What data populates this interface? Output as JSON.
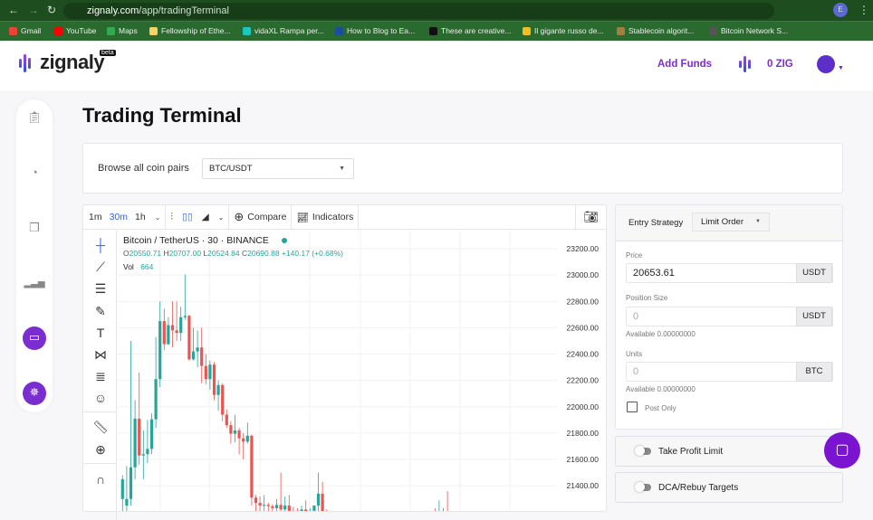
{
  "browser": {
    "url_domain": "zignaly.com",
    "url_path": "/app/tradingTerminal",
    "bookmarks": [
      {
        "label": "Gmail",
        "color": "#ea4335"
      },
      {
        "label": "YouTube",
        "color": "#ff0000"
      },
      {
        "label": "Maps",
        "color": "#34a853"
      },
      {
        "label": "Fellowship of Ethe...",
        "color": "#f6d365"
      },
      {
        "label": "vidaXL Rampa per...",
        "color": "#1cc7c1"
      },
      {
        "label": "How to Blog to Ea...",
        "color": "#1a4fa0"
      },
      {
        "label": "These are creative...",
        "color": "#111111"
      },
      {
        "label": "Il gigante russo de...",
        "color": "#f0c020"
      },
      {
        "label": "Stablecoin algorit...",
        "color": "#a08040"
      },
      {
        "label": "Bitcoin Network S...",
        "color": "#555555"
      }
    ],
    "profile_initial": "E"
  },
  "header": {
    "logo": "zignaly",
    "logo_badge": "beta",
    "add_funds": "Add Funds",
    "balance": "0 ZIG",
    "accent": "#7a2ed0"
  },
  "sidebar": {
    "items": [
      {
        "icon": "clipboard-icon"
      },
      {
        "icon": "pie-chart-icon"
      },
      {
        "icon": "copy-icon"
      },
      {
        "icon": "signal-icon"
      },
      {
        "icon": "monitor-icon",
        "active": true
      },
      {
        "icon": "settings-icon",
        "active": true
      }
    ]
  },
  "page": {
    "title": "Trading Terminal"
  },
  "pair": {
    "label": "Browse all coin pairs",
    "selected": "BTC/USDT"
  },
  "toolbar": {
    "intervals": [
      "1m",
      "30m",
      "1h"
    ],
    "active_interval": "30m",
    "compare": "Compare",
    "indicators": "Indicators"
  },
  "legend": {
    "symbol": "Bitcoin / TetherUS · 30 · BINANCE",
    "o_label": "O",
    "o": "20550.71",
    "h_label": "H",
    "h": "20707.00",
    "l_label": "L",
    "l": "20524.84",
    "c_label": "C",
    "c": "20690.88",
    "change": "+140.17 (+0.68%)",
    "vol_label": "Vol",
    "vol": "664"
  },
  "chart_data": {
    "type": "candlestick",
    "y_ticks": [
      23200,
      23000,
      22800,
      22600,
      22400,
      22200,
      22000,
      21800,
      21600,
      21400
    ],
    "y_tick_labels": [
      "23200.00",
      "23000.00",
      "22800.00",
      "22600.00",
      "22400.00",
      "22200.00",
      "22000.00",
      "21800.00",
      "21600.00",
      "21400.00"
    ],
    "ylim": [
      21237,
      23330
    ],
    "grid": true,
    "up_color": "#26a69a",
    "down_color": "#ef5350",
    "candles_ohlc": [
      [
        21300,
        21480,
        21200,
        21450
      ],
      [
        21250,
        21550,
        21150,
        21300
      ],
      [
        21300,
        22500,
        21250,
        21540
      ],
      [
        21540,
        22050,
        21450,
        21910
      ],
      [
        21910,
        22260,
        21560,
        21630
      ],
      [
        21630,
        21820,
        21450,
        21640
      ],
      [
        21640,
        21900,
        21570,
        21680
      ],
      [
        21680,
        21950,
        21640,
        21905
      ],
      [
        21905,
        22530,
        21840,
        22210
      ],
      [
        22210,
        22800,
        22150,
        22650
      ],
      [
        22650,
        22745,
        22430,
        22475
      ],
      [
        22475,
        22680,
        22470,
        22620
      ],
      [
        22620,
        22800,
        22450,
        22580
      ],
      [
        22580,
        22800,
        22500,
        22560
      ],
      [
        22560,
        22760,
        22500,
        22680
      ],
      [
        22680,
        23005,
        22660,
        22690
      ],
      [
        22690,
        22700,
        22350,
        22360
      ],
      [
        22360,
        22600,
        22350,
        22420
      ],
      [
        22420,
        22580,
        22300,
        22450
      ],
      [
        22450,
        22600,
        22180,
        22310
      ],
      [
        22310,
        22400,
        22170,
        22210
      ],
      [
        22210,
        22350,
        22130,
        22320
      ],
      [
        22320,
        22340,
        22050,
        22090
      ],
      [
        22090,
        22200,
        21970,
        22165
      ],
      [
        22165,
        22180,
        21890,
        21940
      ],
      [
        21940,
        21980,
        21840,
        21860
      ],
      [
        21860,
        21890,
        21720,
        21795
      ],
      [
        21795,
        21940,
        21730,
        21820
      ],
      [
        21820,
        21840,
        21640,
        21760
      ],
      [
        21760,
        21800,
        21600,
        21735
      ],
      [
        21735,
        21880,
        21720,
        21780
      ],
      [
        21780,
        21790,
        21250,
        21310
      ],
      [
        21310,
        21330,
        21200,
        21270
      ],
      [
        21270,
        21320,
        21200,
        21250
      ],
      [
        21250,
        21330,
        21200,
        21255
      ],
      [
        21255,
        21270,
        21200,
        21245
      ],
      [
        21245,
        21260,
        21180,
        21230
      ],
      [
        21230,
        21300,
        21180,
        21255
      ],
      [
        21255,
        21500,
        21180,
        21220
      ],
      [
        21220,
        21320,
        21180,
        21250
      ],
      [
        21250,
        21330,
        21150,
        21210
      ],
      [
        21210,
        21240,
        21150,
        21200
      ],
      [
        21200,
        21230,
        21150,
        21190
      ],
      [
        21190,
        21250,
        21150,
        21220
      ],
      [
        21220,
        21290,
        21150,
        21200
      ],
      [
        21200,
        21230,
        21150,
        21210
      ],
      [
        21210,
        21250,
        21150,
        21250
      ],
      [
        21250,
        21500,
        21200,
        21340
      ],
      [
        21340,
        21430,
        21150,
        21200
      ],
      [
        21200,
        21220,
        21120,
        21180
      ],
      [
        21180,
        21210,
        21120,
        21190
      ],
      [
        21190,
        21200,
        21110,
        21150
      ],
      [
        21150,
        21190,
        21100,
        21170
      ],
      [
        21170,
        21200,
        21120,
        21140
      ],
      [
        21140,
        21180,
        21100,
        21160
      ],
      [
        21160,
        21200,
        21120,
        21130
      ],
      [
        21130,
        21170,
        21090,
        21150
      ],
      [
        21150,
        21190,
        21100,
        21120
      ],
      [
        21120,
        21160,
        21080,
        21140
      ],
      [
        21140,
        21180,
        21100,
        21110
      ],
      [
        21110,
        21150,
        21070,
        21130
      ],
      [
        21130,
        21170,
        21090,
        21100
      ],
      [
        21100,
        21140,
        21060,
        21120
      ],
      [
        21120,
        21160,
        21080,
        21090
      ],
      [
        21090,
        21130,
        21050,
        21110
      ],
      [
        21110,
        21150,
        21070,
        21100
      ],
      [
        21100,
        21140,
        21060,
        21120
      ],
      [
        21120,
        21160,
        21080,
        21100
      ],
      [
        21100,
        21150,
        21060,
        21130
      ],
      [
        21130,
        21180,
        21090,
        21110
      ],
      [
        21110,
        21160,
        21070,
        21140
      ],
      [
        21140,
        21190,
        21100,
        21120
      ],
      [
        21120,
        21180,
        21080,
        21150
      ],
      [
        21150,
        21200,
        21100,
        21130
      ],
      [
        21130,
        21210,
        21090,
        21160
      ],
      [
        21160,
        21230,
        21100,
        21140
      ],
      [
        21140,
        21290,
        21100,
        21180
      ],
      [
        21180,
        21230,
        21120,
        21200
      ],
      [
        21200,
        21360,
        21150,
        21170
      ]
    ]
  },
  "order": {
    "entry_label": "Entry Strategy",
    "entry_value": "Limit Order",
    "price_label": "Price",
    "price_value": "20653.61",
    "price_unit": "USDT",
    "size_label": "Position Size",
    "size_placeholder": "0",
    "size_unit": "USDT",
    "size_available": "Available 0.00000000",
    "units_label": "Units",
    "units_placeholder": "0",
    "units_unit": "BTC",
    "units_available": "Available 0.00000000",
    "post_only": "Post Only",
    "take_profit": "Take Profit Limit",
    "dca": "DCA/Rebuy Targets"
  }
}
